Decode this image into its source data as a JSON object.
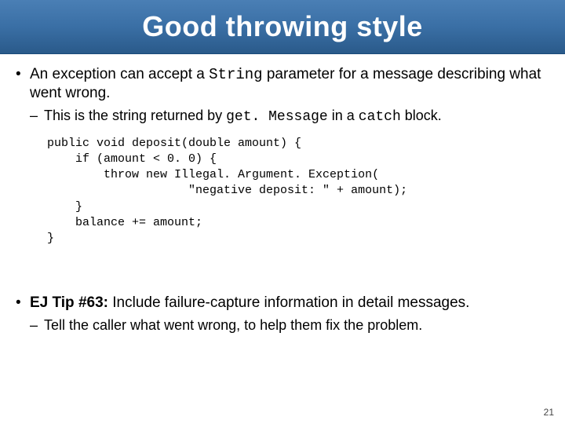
{
  "title": "Good throwing style",
  "bullets": [
    {
      "parts": [
        {
          "t": "An exception can accept a "
        },
        {
          "t": "String",
          "mono": true
        },
        {
          "t": " parameter for a message describing what went wrong."
        }
      ],
      "sub": [
        {
          "parts": [
            {
              "t": "This is the string returned by "
            },
            {
              "t": "get. Message",
              "mono": true
            },
            {
              "t": " in a "
            },
            {
              "t": "catch",
              "mono": true
            },
            {
              "t": " block."
            }
          ]
        }
      ],
      "code": "public void deposit(double amount) {\n    if (amount < 0. 0) {\n        throw new Illegal. Argument. Exception(\n                    \"negative deposit: \" + amount);\n    }\n    balance += amount;\n}"
    },
    {
      "parts": [
        {
          "t": "EJ Tip #63:",
          "bold": true
        },
        {
          "t": " Include failure-capture information in detail messages."
        }
      ],
      "sub": [
        {
          "parts": [
            {
              "t": "Tell the caller what went wrong, to help them fix the problem."
            }
          ]
        }
      ]
    }
  ],
  "page_number": "21"
}
